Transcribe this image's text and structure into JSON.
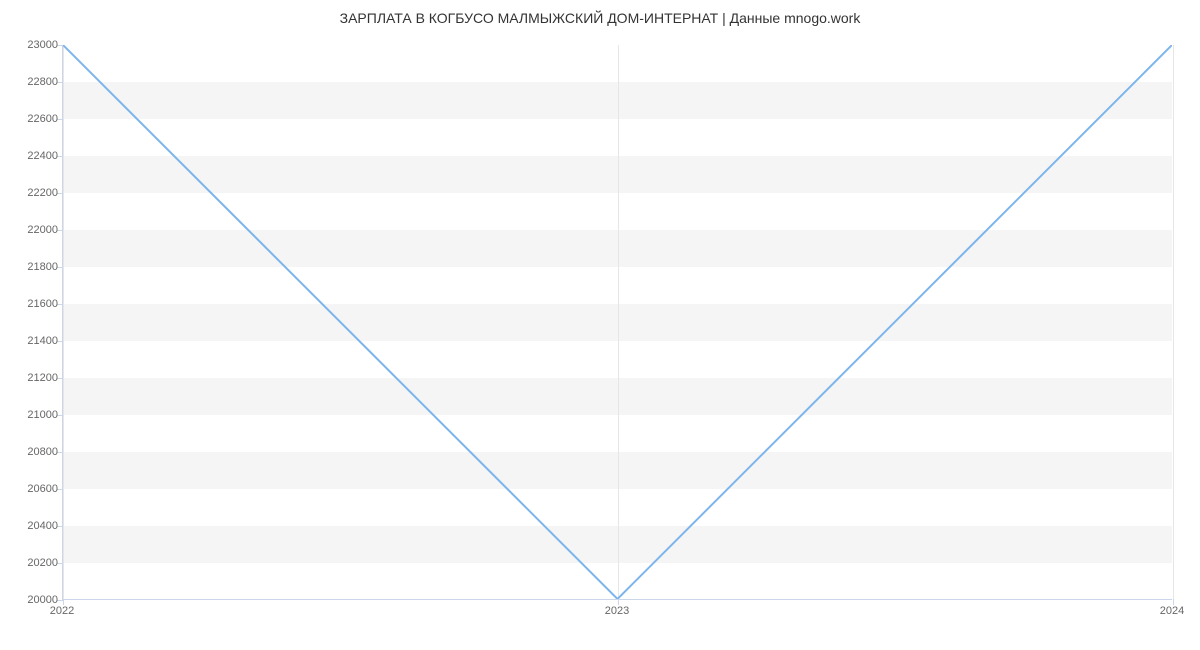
{
  "chart_data": {
    "type": "line",
    "title": "ЗАРПЛАТА В КОГБУСО  МАЛМЫЖСКИЙ ДОМ-ИНТЕРНАТ | Данные mnogo.work",
    "x": [
      2022,
      2023,
      2024
    ],
    "values": [
      23000,
      20000,
      23000
    ],
    "x_ticks": [
      2022,
      2023,
      2024
    ],
    "y_ticks": [
      20000,
      20200,
      20400,
      20600,
      20800,
      21000,
      21200,
      21400,
      21600,
      21800,
      22000,
      22200,
      22400,
      22600,
      22800,
      23000
    ],
    "ylim": [
      20000,
      23000
    ],
    "xlim": [
      2022,
      2024
    ],
    "line_color": "#7cb5ec",
    "xlabel": "",
    "ylabel": ""
  }
}
